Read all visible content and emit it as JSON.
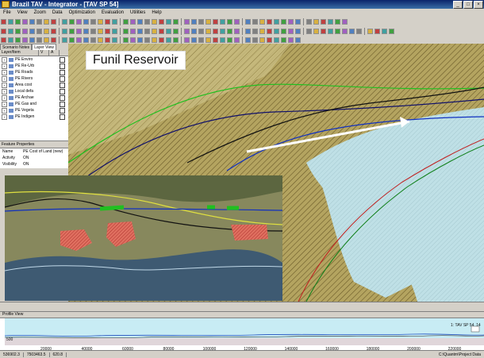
{
  "window": {
    "title": "Brazil TAV - Integrator - [TAV SP 54]"
  },
  "menu": [
    "File",
    "View",
    "Zoom",
    "Data",
    "Optimization",
    "Evaluation",
    "Utilities",
    "Help"
  ],
  "left_panel": {
    "tabs": [
      "Scenario Notes",
      "Layer View"
    ],
    "columns": [
      "Layer/Item",
      "V",
      "A"
    ],
    "layers": [
      "PE Enviro",
      "PE Re-Urb",
      "PE Roads",
      "PE Rivers",
      "Area cost",
      "Local defa",
      "PE Archae",
      "PE Gas and",
      "PE Vegeta",
      "PE Indigen"
    ],
    "feature_properties": {
      "title": "Feature Properties",
      "rows": [
        {
          "key": "Name",
          "value": "PE Cost of Land (new)"
        },
        {
          "key": "Activity",
          "value": "ON"
        },
        {
          "key": "Visibility",
          "value": "ON"
        }
      ]
    }
  },
  "map": {
    "label": "Funil Reservoir"
  },
  "profile": {
    "title": "Profile View",
    "series_label": "1: TAV SP 54_14",
    "y_tick": "500",
    "x_ticks": [
      "20000",
      "40000",
      "60000",
      "80000",
      "100000",
      "120000",
      "140000",
      "160000",
      "180000",
      "200000",
      "220000"
    ]
  },
  "status": {
    "x": "536902.3",
    "y": "7503463.5",
    "z": "620.8",
    "path": "C:\\Quantm\\Project Data"
  },
  "colors": {
    "title_bar": "#0a246a",
    "reservoir": "#bfe0e6",
    "terrain": "#b9a86a",
    "alignment_green": "#20c020",
    "alignment_blue": "#1030c0"
  }
}
